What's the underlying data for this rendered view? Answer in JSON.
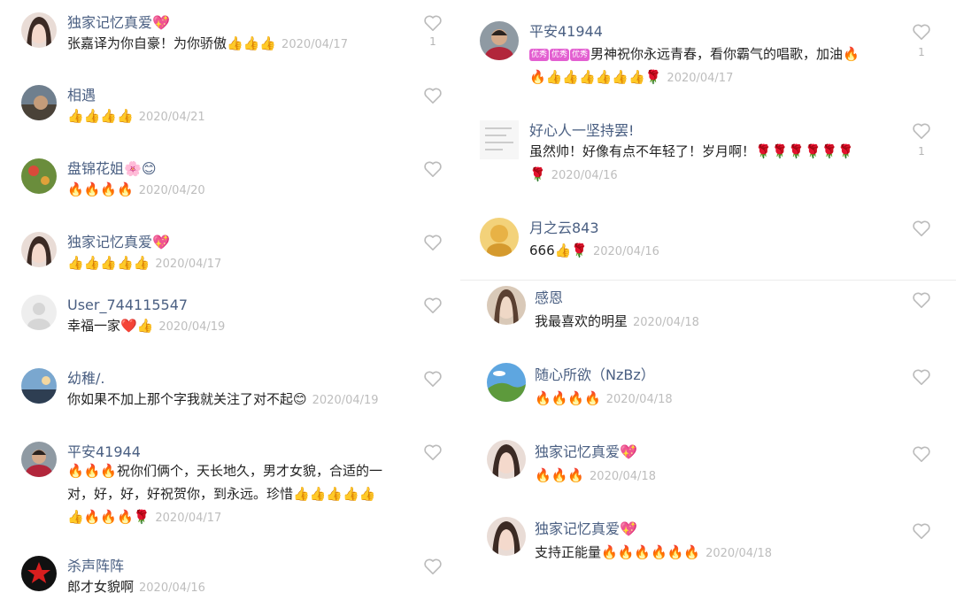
{
  "left": [
    {
      "user": "独家记忆真爱💖",
      "text": "张嘉译为你自豪！为你骄傲👍👍👍",
      "date": "2020/04/17",
      "likes": "1"
    },
    {
      "user": "相遇",
      "text": "👍👍👍👍",
      "date": "2020/04/21",
      "likes": ""
    },
    {
      "user": "盘锦花姐🌸😊",
      "text": "🔥🔥🔥🔥",
      "date": "2020/04/20",
      "likes": ""
    },
    {
      "user": "独家记忆真爱💖",
      "text": "👍👍👍👍👍",
      "date": "2020/04/17",
      "likes": ""
    },
    {
      "user": "User_744115547",
      "text": "幸福一家❤️👍",
      "date": "2020/04/19",
      "likes": ""
    },
    {
      "user": "幼稚/.",
      "text": "你如果不加上那个字我就关注了对不起😊",
      "date": "2020/04/19",
      "likes": ""
    },
    {
      "user": "平安41944",
      "line1": "🔥🔥🔥祝你们俩个，天长地久，男才女貌，合适的一",
      "line2": "对，好，好，好祝贺你，到永远。珍惜👍👍👍👍👍",
      "line3": "👍🔥🔥🔥🌹",
      "date": "2020/04/17",
      "likes": ""
    },
    {
      "user": "杀声阵阵",
      "text": "郎才女貌啊",
      "date": "2020/04/16",
      "likes": ""
    }
  ],
  "right_top": [
    {
      "user": "平安41944",
      "badges": [
        "优秀",
        "优秀",
        "优秀"
      ],
      "line1": "男神祝你永远青春，看你霸气的唱歌，加油🔥",
      "line2": "🔥👍👍👍👍👍👍🌹",
      "date": "2020/04/17",
      "likes": "1"
    },
    {
      "user": "好心人一坚持罢!",
      "line1": "虽然帅！好像有点不年轻了！岁月啊！🌹🌹🌹🌹🌹🌹",
      "line2": "🌹",
      "date": "2020/04/16",
      "likes": "1"
    },
    {
      "user": "月之云843",
      "text": "666👍🌹",
      "date": "2020/04/16",
      "likes": ""
    }
  ],
  "right_bottom": [
    {
      "user": "感恩",
      "text": "我最喜欢的明星",
      "date": "2020/04/18",
      "likes": ""
    },
    {
      "user": "随心所欲（NzBz）",
      "text": "🔥🔥🔥🔥",
      "date": "2020/04/18",
      "likes": ""
    },
    {
      "user": "独家记忆真爱💖",
      "text": "🔥🔥🔥",
      "date": "2020/04/18",
      "likes": ""
    },
    {
      "user": "独家记忆真爱💖",
      "text": "支持正能量🔥🔥🔥🔥🔥🔥",
      "date": "2020/04/18",
      "likes": ""
    }
  ],
  "colors": {
    "username": "#4a5f82",
    "date": "#bdbdbd",
    "text": "#222222",
    "heart": "#bbbbbb"
  },
  "icons": [
    "heart-outline-icon",
    "avatar-photo"
  ]
}
